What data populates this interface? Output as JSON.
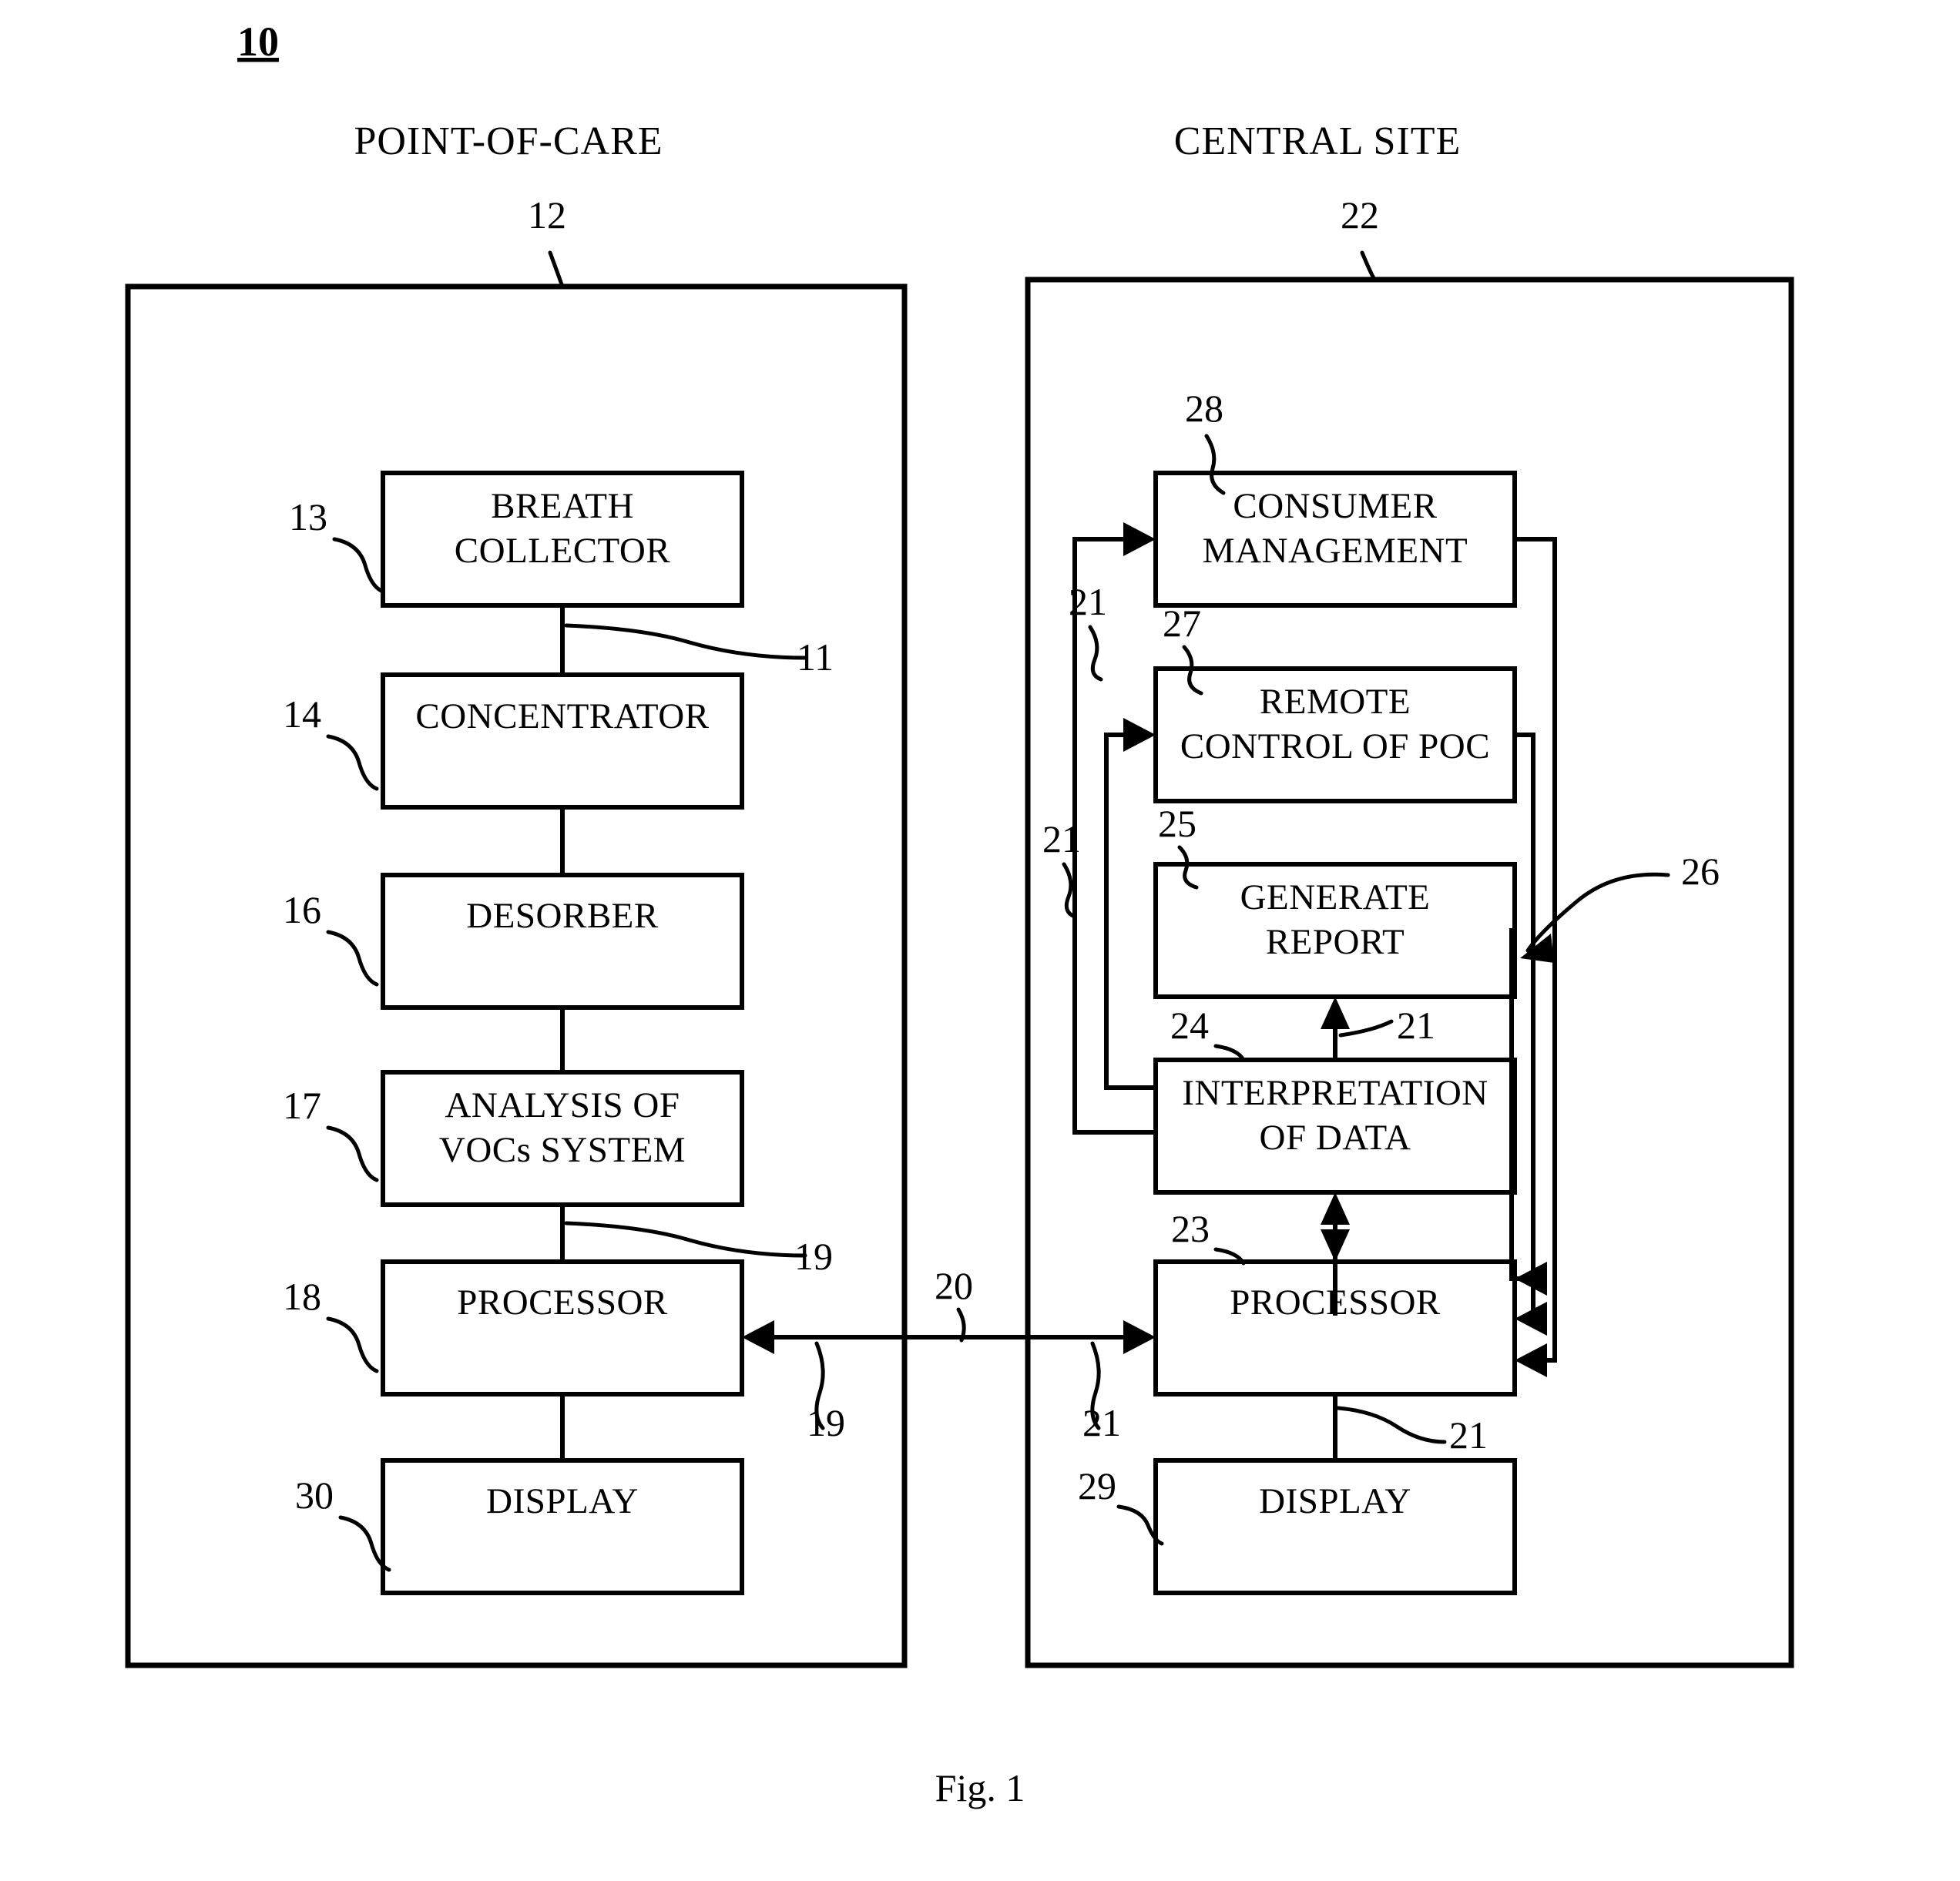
{
  "figure": {
    "top_reference": "10",
    "caption": "Fig. 1"
  },
  "columns": {
    "left": {
      "heading": "POINT-OF-CARE",
      "reference": "12"
    },
    "right": {
      "heading": "CENTRAL SITE",
      "reference": "22"
    }
  },
  "left_blocks": [
    {
      "ref": "13",
      "line1": "BREATH",
      "line2": "COLLECTOR"
    },
    {
      "ref": "14",
      "line1": "CONCENTRATOR",
      "line2": ""
    },
    {
      "ref": "16",
      "line1": "DESORBER",
      "line2": ""
    },
    {
      "ref": "17",
      "line1": "ANALYSIS OF",
      "line2": "VOCs SYSTEM"
    },
    {
      "ref": "18",
      "line1": "PROCESSOR",
      "line2": ""
    },
    {
      "ref": "30",
      "line1": "DISPLAY",
      "line2": ""
    }
  ],
  "right_blocks": [
    {
      "ref": "28",
      "line1": "CONSUMER",
      "line2": "MANAGEMENT"
    },
    {
      "ref": "27",
      "line1": "REMOTE",
      "line2": "CONTROL OF POC"
    },
    {
      "ref": "25",
      "line1": "GENERATE",
      "line2": "REPORT"
    },
    {
      "ref": "24",
      "line1": "INTERPRETATION",
      "line2": "OF DATA"
    },
    {
      "ref": "23",
      "line1": "PROCESSOR",
      "line2": ""
    },
    {
      "ref": "29",
      "line1": "DISPLAY",
      "line2": ""
    }
  ],
  "connector_refs": {
    "left_internal_upper": "11",
    "left_internal_lower": "19",
    "left_link_to_bus": "19",
    "bus": "20",
    "right_bus_entry": "21",
    "right_internal_a": "21",
    "right_internal_b": "21",
    "right_internal_c": "21",
    "right_internal_d": "21",
    "right_internal_e": "21",
    "right_feedback": "26"
  },
  "colors": {
    "ink": "#000000",
    "paper": "#ffffff"
  }
}
